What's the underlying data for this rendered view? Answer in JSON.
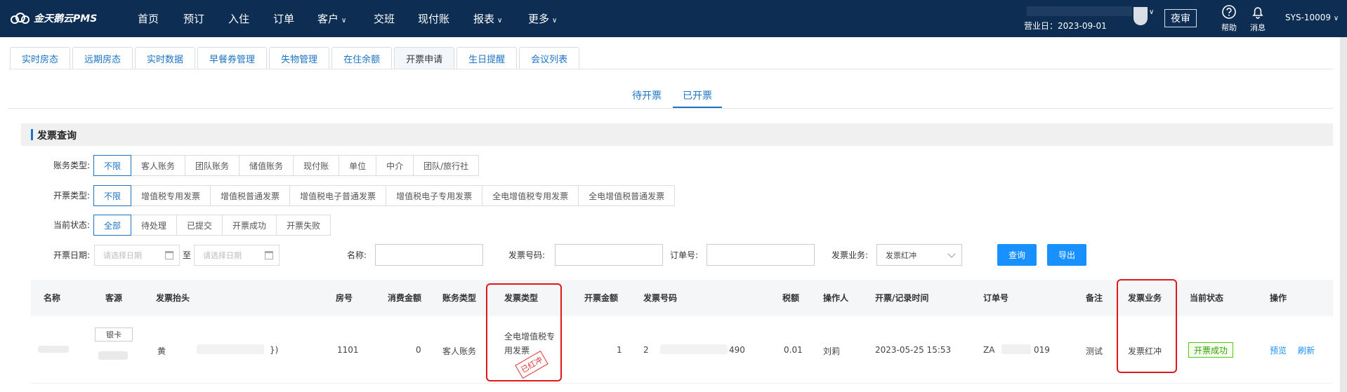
{
  "app": {
    "logo_text": "金天鹅云PMS"
  },
  "nav": {
    "items": [
      {
        "label": "首页"
      },
      {
        "label": "预订"
      },
      {
        "label": "入住"
      },
      {
        "label": "订单"
      },
      {
        "label": "客户"
      },
      {
        "label": "交班"
      },
      {
        "label": "现付账"
      },
      {
        "label": "报表"
      },
      {
        "label": "更多"
      }
    ],
    "business_date": "营业日：2023-09-01",
    "night_audit_label": "夜审",
    "help_label": "帮助",
    "message_label": "消息",
    "user": "SYS-10009"
  },
  "tabs": [
    {
      "label": "实时房态"
    },
    {
      "label": "远期房态"
    },
    {
      "label": "实时数据"
    },
    {
      "label": "早餐券管理"
    },
    {
      "label": "失物管理"
    },
    {
      "label": "在住余额"
    },
    {
      "label": "开票申请"
    },
    {
      "label": "生日提醒"
    },
    {
      "label": "会议列表"
    }
  ],
  "subtabs": [
    {
      "label": "待开票"
    },
    {
      "label": "已开票"
    }
  ],
  "section": {
    "title": "发票查询"
  },
  "filters": {
    "account_type": {
      "label": "账务类型:",
      "options": [
        "不限",
        "客人账务",
        "团队账务",
        "储值账务",
        "现付账",
        "单位",
        "中介",
        "团队/旅行社"
      ]
    },
    "invoice_type": {
      "label": "开票类型:",
      "options": [
        "不限",
        "增值税专用发票",
        "增值税普通发票",
        "增值税电子普通发票",
        "增值税电子专用发票",
        "全电增值税专用发票",
        "全电增值税普通发票"
      ]
    },
    "status": {
      "label": "当前状态:",
      "options": [
        "全部",
        "待处理",
        "已提交",
        "开票成功",
        "开票失败"
      ]
    },
    "date": {
      "label": "开票日期:",
      "start_placeholder": "请选择日期",
      "separator": "至",
      "end_placeholder": "请选择日期"
    },
    "name_label": "名称:",
    "invoice_no_label": "发票号码:",
    "order_no_label": "订单号:",
    "business_label": "发票业务:",
    "business_value": "发票红冲",
    "query_button": "查询",
    "export_button": "导出"
  },
  "table": {
    "headers": [
      "名称",
      "客源",
      "发票抬头",
      "房号",
      "消费金额",
      "账务类型",
      "发票类型",
      "开票金额",
      "发票号码",
      "税额",
      "操作人",
      "开票/记录时间",
      "订单号",
      "备注",
      "发票业务",
      "当前状态",
      "操作"
    ],
    "rows": [
      {
        "source_tag": "银卡",
        "title_prefix": "黄",
        "title_suffix": "})",
        "room": "1101",
        "amount": "0",
        "account_type": "客人账务",
        "invoice_type": "全电增值税专用发票",
        "invoice_amount": "1",
        "invoice_no_prefix": "2",
        "invoice_no_suffix": "490",
        "tax": "0.01",
        "operator": "刘莉",
        "time": "2023-05-25 15:53",
        "order_prefix": "ZA",
        "order_suffix": "019",
        "remark": "测试",
        "business": "发票红冲",
        "status": "开票成功",
        "stamp": "已红冲",
        "actions": [
          "预览",
          "刷新"
        ]
      }
    ]
  }
}
